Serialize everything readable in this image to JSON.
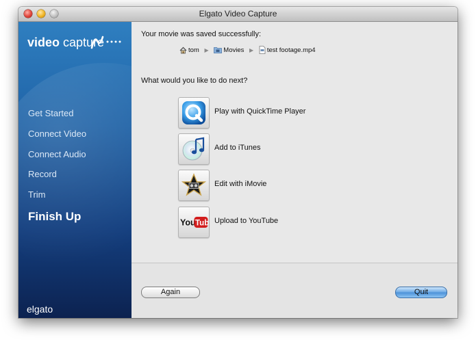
{
  "window": {
    "title": "Elgato Video Capture"
  },
  "sidebar": {
    "logo": {
      "bold": "video",
      "thin": "capture"
    },
    "items": [
      {
        "label": "Get Started",
        "active": false
      },
      {
        "label": "Connect Video",
        "active": false
      },
      {
        "label": "Connect Audio",
        "active": false
      },
      {
        "label": "Record",
        "active": false
      },
      {
        "label": "Trim",
        "active": false
      },
      {
        "label": "Finish Up",
        "active": true
      }
    ],
    "brand": "elgato"
  },
  "main": {
    "saved_message": "Your movie was saved successfully:",
    "path": [
      {
        "label": "tom",
        "icon": "home-icon"
      },
      {
        "label": "Movies",
        "icon": "folder-icon"
      },
      {
        "label": "test footage.mp4",
        "icon": "file-icon"
      }
    ],
    "next_question": "What would you like to do next?",
    "actions": [
      {
        "label": "Play with QuickTime Player",
        "icon": "quicktime-icon"
      },
      {
        "label": "Add to iTunes",
        "icon": "itunes-icon"
      },
      {
        "label": "Edit with iMovie",
        "icon": "imovie-icon"
      },
      {
        "label": "Upload to YouTube",
        "icon": "youtube-icon",
        "icon_text": {
          "you": "You",
          "tube": "Tube"
        }
      }
    ]
  },
  "footer": {
    "again_label": "Again",
    "quit_label": "Quit"
  },
  "colors": {
    "sidebar_top": "#2f7fc0",
    "sidebar_bottom": "#0c2250",
    "default_button": "#4a90d8"
  }
}
